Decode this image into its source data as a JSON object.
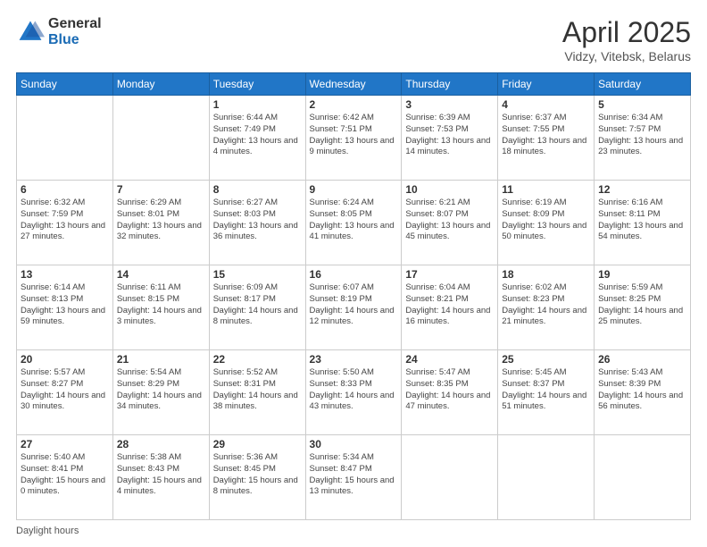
{
  "logo": {
    "general": "General",
    "blue": "Blue"
  },
  "title": "April 2025",
  "subtitle": "Vidzy, Vitebsk, Belarus",
  "days_of_week": [
    "Sunday",
    "Monday",
    "Tuesday",
    "Wednesday",
    "Thursday",
    "Friday",
    "Saturday"
  ],
  "weeks": [
    [
      {
        "num": "",
        "info": ""
      },
      {
        "num": "",
        "info": ""
      },
      {
        "num": "1",
        "info": "Sunrise: 6:44 AM\nSunset: 7:49 PM\nDaylight: 13 hours and 4 minutes."
      },
      {
        "num": "2",
        "info": "Sunrise: 6:42 AM\nSunset: 7:51 PM\nDaylight: 13 hours and 9 minutes."
      },
      {
        "num": "3",
        "info": "Sunrise: 6:39 AM\nSunset: 7:53 PM\nDaylight: 13 hours and 14 minutes."
      },
      {
        "num": "4",
        "info": "Sunrise: 6:37 AM\nSunset: 7:55 PM\nDaylight: 13 hours and 18 minutes."
      },
      {
        "num": "5",
        "info": "Sunrise: 6:34 AM\nSunset: 7:57 PM\nDaylight: 13 hours and 23 minutes."
      }
    ],
    [
      {
        "num": "6",
        "info": "Sunrise: 6:32 AM\nSunset: 7:59 PM\nDaylight: 13 hours and 27 minutes."
      },
      {
        "num": "7",
        "info": "Sunrise: 6:29 AM\nSunset: 8:01 PM\nDaylight: 13 hours and 32 minutes."
      },
      {
        "num": "8",
        "info": "Sunrise: 6:27 AM\nSunset: 8:03 PM\nDaylight: 13 hours and 36 minutes."
      },
      {
        "num": "9",
        "info": "Sunrise: 6:24 AM\nSunset: 8:05 PM\nDaylight: 13 hours and 41 minutes."
      },
      {
        "num": "10",
        "info": "Sunrise: 6:21 AM\nSunset: 8:07 PM\nDaylight: 13 hours and 45 minutes."
      },
      {
        "num": "11",
        "info": "Sunrise: 6:19 AM\nSunset: 8:09 PM\nDaylight: 13 hours and 50 minutes."
      },
      {
        "num": "12",
        "info": "Sunrise: 6:16 AM\nSunset: 8:11 PM\nDaylight: 13 hours and 54 minutes."
      }
    ],
    [
      {
        "num": "13",
        "info": "Sunrise: 6:14 AM\nSunset: 8:13 PM\nDaylight: 13 hours and 59 minutes."
      },
      {
        "num": "14",
        "info": "Sunrise: 6:11 AM\nSunset: 8:15 PM\nDaylight: 14 hours and 3 minutes."
      },
      {
        "num": "15",
        "info": "Sunrise: 6:09 AM\nSunset: 8:17 PM\nDaylight: 14 hours and 8 minutes."
      },
      {
        "num": "16",
        "info": "Sunrise: 6:07 AM\nSunset: 8:19 PM\nDaylight: 14 hours and 12 minutes."
      },
      {
        "num": "17",
        "info": "Sunrise: 6:04 AM\nSunset: 8:21 PM\nDaylight: 14 hours and 16 minutes."
      },
      {
        "num": "18",
        "info": "Sunrise: 6:02 AM\nSunset: 8:23 PM\nDaylight: 14 hours and 21 minutes."
      },
      {
        "num": "19",
        "info": "Sunrise: 5:59 AM\nSunset: 8:25 PM\nDaylight: 14 hours and 25 minutes."
      }
    ],
    [
      {
        "num": "20",
        "info": "Sunrise: 5:57 AM\nSunset: 8:27 PM\nDaylight: 14 hours and 30 minutes."
      },
      {
        "num": "21",
        "info": "Sunrise: 5:54 AM\nSunset: 8:29 PM\nDaylight: 14 hours and 34 minutes."
      },
      {
        "num": "22",
        "info": "Sunrise: 5:52 AM\nSunset: 8:31 PM\nDaylight: 14 hours and 38 minutes."
      },
      {
        "num": "23",
        "info": "Sunrise: 5:50 AM\nSunset: 8:33 PM\nDaylight: 14 hours and 43 minutes."
      },
      {
        "num": "24",
        "info": "Sunrise: 5:47 AM\nSunset: 8:35 PM\nDaylight: 14 hours and 47 minutes."
      },
      {
        "num": "25",
        "info": "Sunrise: 5:45 AM\nSunset: 8:37 PM\nDaylight: 14 hours and 51 minutes."
      },
      {
        "num": "26",
        "info": "Sunrise: 5:43 AM\nSunset: 8:39 PM\nDaylight: 14 hours and 56 minutes."
      }
    ],
    [
      {
        "num": "27",
        "info": "Sunrise: 5:40 AM\nSunset: 8:41 PM\nDaylight: 15 hours and 0 minutes."
      },
      {
        "num": "28",
        "info": "Sunrise: 5:38 AM\nSunset: 8:43 PM\nDaylight: 15 hours and 4 minutes."
      },
      {
        "num": "29",
        "info": "Sunrise: 5:36 AM\nSunset: 8:45 PM\nDaylight: 15 hours and 8 minutes."
      },
      {
        "num": "30",
        "info": "Sunrise: 5:34 AM\nSunset: 8:47 PM\nDaylight: 15 hours and 13 minutes."
      },
      {
        "num": "",
        "info": ""
      },
      {
        "num": "",
        "info": ""
      },
      {
        "num": "",
        "info": ""
      }
    ]
  ],
  "footer": "Daylight hours"
}
